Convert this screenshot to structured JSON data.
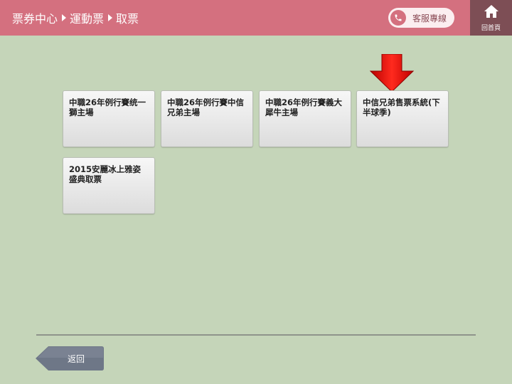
{
  "header": {
    "breadcrumb": [
      "票券中心",
      "運動票",
      "取票"
    ],
    "service_label": "客服專線",
    "home_label": "回首頁"
  },
  "tiles": [
    {
      "label": "中職26年例行賽统一獅主場"
    },
    {
      "label": "中職26年例行賽中信兄弟主場"
    },
    {
      "label": "中職26年例行賽義大犀牛主場"
    },
    {
      "label": "中信兄弟售票系統(下半球季)"
    },
    {
      "label": "2015安麗冰上雅姿盛典取票"
    }
  ],
  "footer": {
    "back_label": "返回"
  },
  "icons": {
    "phone": "phone-icon",
    "home": "home-icon",
    "pointer": "red-down-arrow-icon"
  },
  "colors": {
    "header": "#d4707f",
    "home_button": "#7d4e55",
    "background": "#c5d5b9",
    "arrow": "#e8140f",
    "back_button": "#6e7787"
  }
}
